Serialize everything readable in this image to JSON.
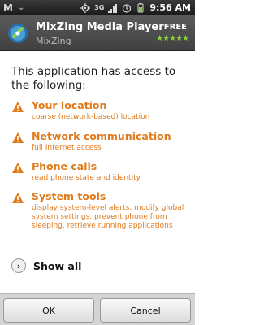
{
  "statusbar": {
    "notification": "M",
    "network": "3G",
    "time": "9:56 AM"
  },
  "app": {
    "title": "MixZing Media Player",
    "developer": "MixZing",
    "price": "FREE",
    "rating": "★★★★★"
  },
  "intro": "This application has access to the following:",
  "permissions": [
    {
      "title": "Your location",
      "desc": "coarse (network-based) location"
    },
    {
      "title": "Network communication",
      "desc": "full Internet access"
    },
    {
      "title": "Phone calls",
      "desc": "read phone state and identity"
    },
    {
      "title": "System tools",
      "desc": "display system-level alerts, modify global system settings, prevent phone from sleeping, retrieve running applications"
    }
  ],
  "show_all": {
    "icon": "chevron-right-icon",
    "label": "Show all"
  },
  "buttons": {
    "ok": "OK",
    "cancel": "Cancel"
  },
  "colors": {
    "warning": "#e07b1c",
    "header": "#4b4b4b",
    "rating": "#8bd23c"
  }
}
